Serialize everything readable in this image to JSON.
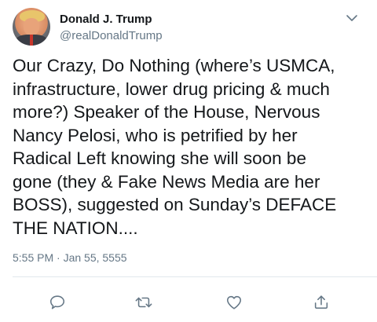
{
  "user": {
    "display_name": "Donald J. Trump",
    "handle": "@realDonaldTrump",
    "avatar_icon": "profile-photo"
  },
  "tweet": {
    "text": "Our Crazy, Do Nothing (where’s USMCA,\ninfrastructure, lower drug pricing & much\nmore?) Speaker of the House, Nervous\nNancy Pelosi, who is petrified by her\nRadical Left knowing she will soon be\ngone (they & Fake News Media are her\nBOSS), suggested on Sunday’s DEFACE\nTHE NATION....",
    "timestamp": "5:55 PM · Jan 55, 5555"
  },
  "actions": [
    {
      "name": "reply",
      "icon": "speech-bubble-icon"
    },
    {
      "name": "retweet",
      "icon": "retweet-arrows-icon"
    },
    {
      "name": "like",
      "icon": "heart-icon"
    },
    {
      "name": "share",
      "icon": "share-upload-icon"
    }
  ],
  "colors": {
    "text": "#14171a",
    "secondary": "#657786",
    "icon": "#657786",
    "divider": "#e1e8ed"
  }
}
